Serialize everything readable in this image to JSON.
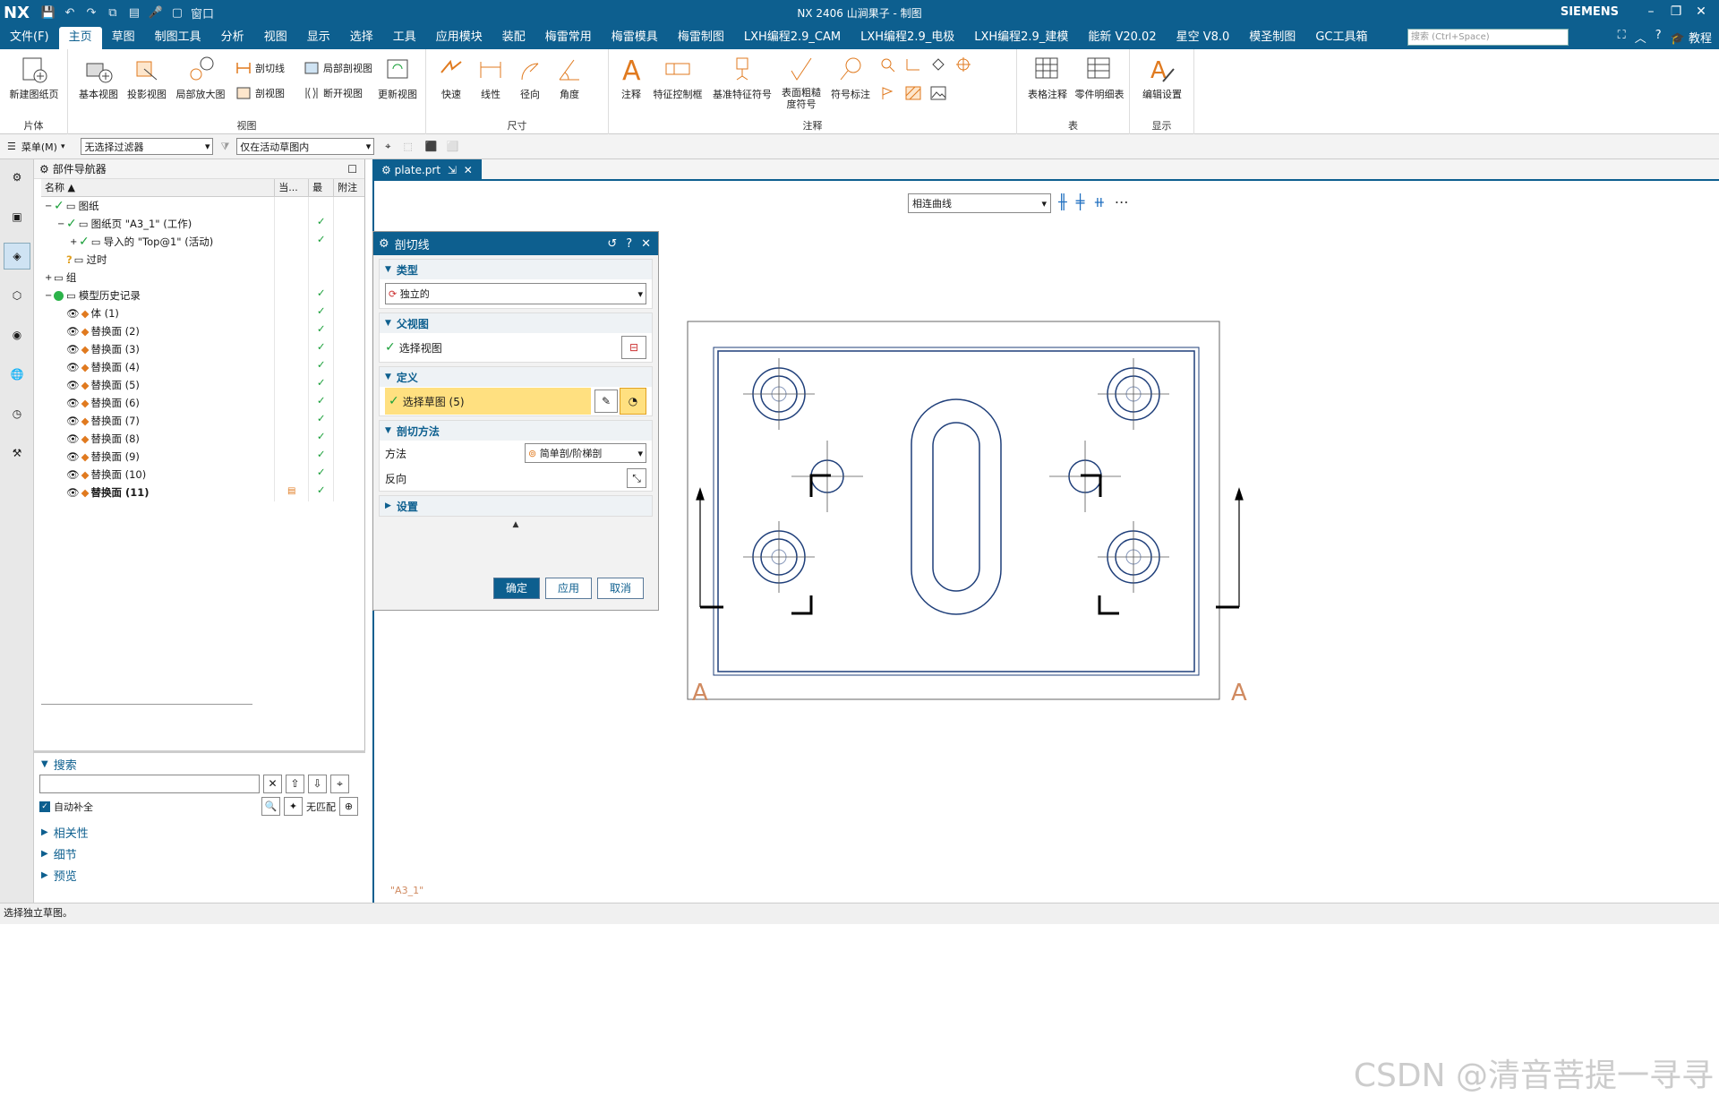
{
  "app": {
    "logo": "NX",
    "title": "NX 2406 山涧果子 - 制图",
    "brand": "SIEMENS",
    "window_menu": "窗口"
  },
  "menu": {
    "items": [
      "文件(F)",
      "主页",
      "草图",
      "制图工具",
      "分析",
      "视图",
      "显示",
      "选择",
      "工具",
      "应用模块",
      "装配",
      "梅雷常用",
      "梅雷模具",
      "梅雷制图",
      "LXH编程2.9_CAM",
      "LXH编程2.9_电极",
      "LXH编程2.9_建模",
      "能新 V20.02",
      "星空 V8.0",
      "模圣制图",
      "GC工具箱"
    ],
    "active": 1,
    "search_placeholder": "搜索 (Ctrl+Space)",
    "tutorial": "教程"
  },
  "ribbon": {
    "groups": {
      "sheet": "片体",
      "view": "视图",
      "dimension": "尺寸",
      "annotation": "注释",
      "table": "表",
      "display": "显示"
    },
    "new_sheet": "新建图纸页",
    "base_view": "基本视图",
    "proj_view": "投影视图",
    "detail_view": "局部放大图",
    "section_line": "剖切线",
    "section_view": "剖视图",
    "local_section": "局部剖视图",
    "break_view": "断开视图",
    "update_view": "更新视图",
    "rapid": "快速",
    "linear": "线性",
    "radial": "径向",
    "angular": "角度",
    "note": "注释",
    "fcf": "特征控制框",
    "datum": "基准特征符号",
    "surface": "表面粗糙度符号",
    "symbol": "符号标注",
    "table_note": "表格注释",
    "parts_list": "零件明细表",
    "edit_settings": "编辑设置"
  },
  "filterbar": {
    "menu": "菜单(M)",
    "filter": "无选择过滤器",
    "scope": "仅在活动草图内"
  },
  "navigator": {
    "title": "部件导航器",
    "columns": [
      "名称",
      "当...",
      "最",
      "附注"
    ],
    "rows": [
      {
        "label": "图纸",
        "indent": 0,
        "toggle": "−",
        "chk": true,
        "c3": false
      },
      {
        "label": "图纸页 \"A3_1\" (工作)",
        "indent": 1,
        "toggle": "−",
        "chk": true,
        "c3": true
      },
      {
        "label": "导入的 \"Top@1\" (活动)",
        "indent": 2,
        "toggle": "+",
        "chk": true,
        "c3": true
      },
      {
        "label": "过时",
        "indent": 1,
        "toggle": "",
        "chk": false,
        "q": true,
        "c3": false
      },
      {
        "label": "组",
        "indent": 0,
        "toggle": "+",
        "chk": false,
        "c3": false
      },
      {
        "label": "模型历史记录",
        "indent": 0,
        "toggle": "−",
        "chk": false,
        "ball": true,
        "c3": true
      },
      {
        "label": "体 (1)",
        "indent": 1,
        "toggle": "",
        "eye": true,
        "c3": true
      },
      {
        "label": "替换面 (2)",
        "indent": 1,
        "toggle": "",
        "eye": true,
        "c3": true
      },
      {
        "label": "替换面 (3)",
        "indent": 1,
        "toggle": "",
        "eye": true,
        "c3": true
      },
      {
        "label": "替换面 (4)",
        "indent": 1,
        "toggle": "",
        "eye": true,
        "c3": true
      },
      {
        "label": "替换面 (5)",
        "indent": 1,
        "toggle": "",
        "eye": true,
        "c3": true
      },
      {
        "label": "替换面 (6)",
        "indent": 1,
        "toggle": "",
        "eye": true,
        "c3": true
      },
      {
        "label": "替换面 (7)",
        "indent": 1,
        "toggle": "",
        "eye": true,
        "c3": true
      },
      {
        "label": "替换面 (8)",
        "indent": 1,
        "toggle": "",
        "eye": true,
        "c3": true
      },
      {
        "label": "替换面 (9)",
        "indent": 1,
        "toggle": "",
        "eye": true,
        "c3": true
      },
      {
        "label": "替换面 (10)",
        "indent": 1,
        "toggle": "",
        "eye": true,
        "c3": true
      },
      {
        "label": "替换面 (11)",
        "indent": 1,
        "toggle": "",
        "eye": true,
        "c3": true,
        "bold": true
      }
    ],
    "search": {
      "title": "搜索",
      "autocomplete": "自动补全",
      "no_match": "无匹配"
    },
    "sections": [
      "相关性",
      "细节",
      "预览"
    ]
  },
  "document": {
    "tab": "plate.prt",
    "curve_dropdown": "相连曲线",
    "sheet_label": "\"A3_1\"",
    "section_labels": [
      "A",
      "A"
    ]
  },
  "dialog": {
    "title": "剖切线",
    "type": {
      "title": "类型",
      "value": "独立的"
    },
    "parent": {
      "title": "父视图",
      "label": "选择视图"
    },
    "define": {
      "title": "定义",
      "label": "选择草图 (5)"
    },
    "method": {
      "title": "剖切方法",
      "method_label": "方法",
      "method_value": "简单剖/阶梯剖",
      "reverse_label": "反向"
    },
    "settings": "设置",
    "ok": "确定",
    "apply": "应用",
    "cancel": "取消"
  },
  "status": "选择独立草图。",
  "watermark": "CSDN @清音菩提一寻寻",
  "colors": {
    "nx_blue": "#0d5f8f",
    "drawing_line": "#1f3f7a",
    "highlight": "#ffe080",
    "accent_orange": "#e07a1f"
  }
}
